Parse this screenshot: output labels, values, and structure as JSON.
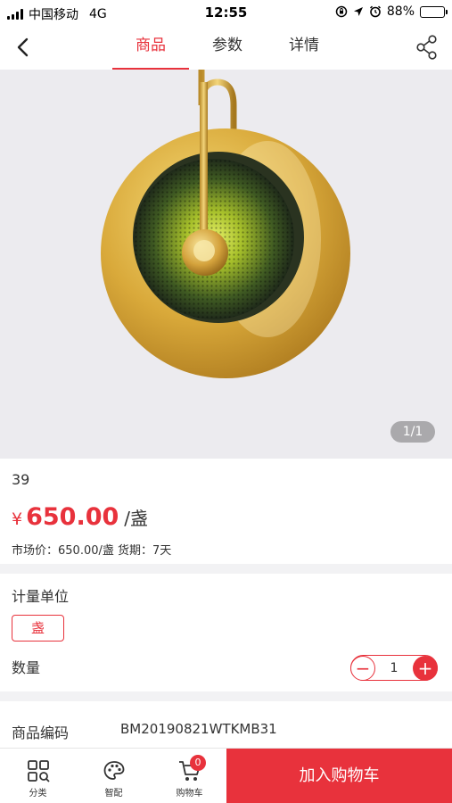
{
  "status_bar": {
    "carrier": "中国移动",
    "network": "4G",
    "time": "12:55",
    "battery": "88%",
    "battery_level": 0.88
  },
  "nav": {
    "tabs": [
      {
        "label": "商品",
        "active": true
      },
      {
        "label": "参数",
        "active": false
      },
      {
        "label": "详情",
        "active": false
      }
    ]
  },
  "gallery": {
    "pager": "1/1"
  },
  "product": {
    "name": "39",
    "price_symbol": "¥",
    "price": "650.00",
    "price_unit": "/盏",
    "market_line": "市场价：650.00/盏 货期：7天"
  },
  "spec": {
    "unit_label": "计量单位",
    "unit_option": "盏",
    "qty_label": "数量",
    "qty_value": "1",
    "minus": "−",
    "plus": "+"
  },
  "code": {
    "label": "商品编码",
    "value": "BM20190821WTKMB31"
  },
  "bottom_bar": {
    "category": "分类",
    "smart": "智配",
    "cart": "购物车",
    "cart_count": "0",
    "add_to_cart": "加入购物车"
  },
  "colors": {
    "accent": "#e8323c",
    "gallery_bg": "#ecebef"
  }
}
